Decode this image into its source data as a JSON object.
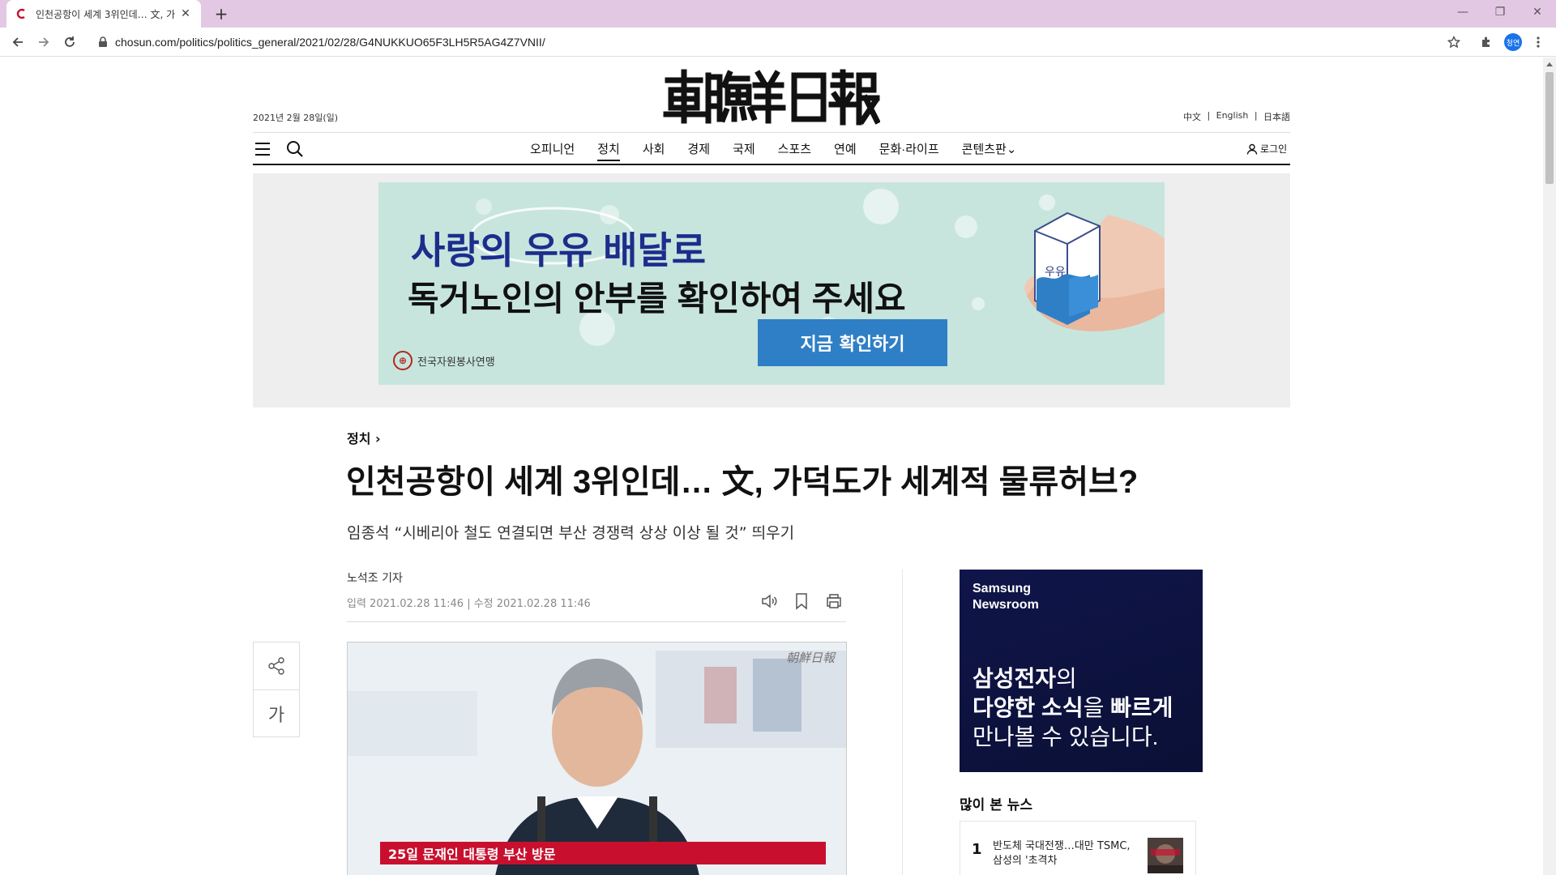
{
  "browser": {
    "tab_title": "인천공항이 세계 3위인데… 文, 가",
    "tab_close": "✕",
    "new_tab": "+",
    "url": "chosun.com/politics/politics_general/2021/02/28/G4NUKKUO65F3LH5R5AG4Z7VNII/",
    "profile_initials": "청연",
    "window_controls": [
      "—",
      "❐",
      "✕"
    ]
  },
  "header": {
    "date": "2021년 2월 28일(일)",
    "languages": [
      "中文",
      "|",
      "English",
      "|",
      "日本語"
    ],
    "login_label": "로그인"
  },
  "nav": {
    "items": [
      {
        "label": "오피니언",
        "active": false
      },
      {
        "label": "정치",
        "active": true
      },
      {
        "label": "사회",
        "active": false
      },
      {
        "label": "경제",
        "active": false
      },
      {
        "label": "국제",
        "active": false
      },
      {
        "label": "스포츠",
        "active": false
      },
      {
        "label": "연예",
        "active": false
      },
      {
        "label": "문화·라이프",
        "active": false
      },
      {
        "label": "콘텐츠판⌄",
        "active": false
      }
    ]
  },
  "ad_banner": {
    "line1": "사랑의 우유 배달로",
    "line2": "독거노인의 안부를 확인하여 주세요",
    "cta": "지금 확인하기",
    "org": "전국자원봉사연맹",
    "carton_label": "우유",
    "colors": {
      "background": "#c7e5dd",
      "cta": "#2f7fc6"
    }
  },
  "article": {
    "section": "정치 ›",
    "headline": "인천공항이 세계 3위인데… 文, 가덕도가 세계적 물류허브?",
    "subhead": "임종석 “시베리아 철도 연결되면 부산 경쟁력 상상 이상 될 것” 띄우기",
    "reporter": "노석조 기자",
    "dates": "입력 2021.02.28 11:46 | 수정 2021.02.28 11:46",
    "photo": {
      "caption": "25일 문재인 대통령 부산 방문"
    }
  },
  "side_tools": {
    "font_label": "가"
  },
  "samsung_ad": {
    "brand_line1": "Samsung",
    "brand_line2": "Newsroom",
    "msg_line1_bold": "삼성전자",
    "msg_line1_rest": "의",
    "msg_line2_bold1": "다양한 소식",
    "msg_line2_mid": "을 ",
    "msg_line2_bold2": "빠르게",
    "msg_line3": "만나볼 수 있습니다."
  },
  "popular": {
    "title": "많이 본 뉴스",
    "items": [
      {
        "rank": "1",
        "text": "반도체 국대전쟁…대만 TSMC, 삼성의 '초격차"
      }
    ]
  }
}
